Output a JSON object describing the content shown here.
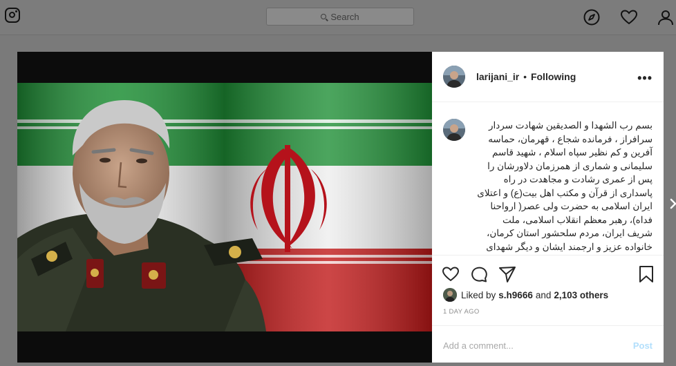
{
  "topbar": {
    "search_placeholder": "Search"
  },
  "post": {
    "username": "larijani_ir",
    "separator": "•",
    "follow_status": "Following",
    "more_label": "•••",
    "caption": "بسم رب الشهدا و الصدیقین شهادت سردار سرافراز ، فرمانده شجاع ، قهرمان، حماسه آفرین و کم نظیر سپاه اسلام ، شهید قاسم سلیمانی و شماری از همرزمان دلاورشان را پس از عمری رشادت و مجاهدت در راه پاسداری از قرآن و مکتب اهل بیت(ع) و اعتلای ایران اسلامی به حضرت ولی عصر( ارواحنا فداه)، رهبر معظم انقلاب اسلامی، ملت شریف ایران، مردم سلحشور استان کرمان، خانواده عزیز و ارجمند ایشان و دیگر شهدای",
    "liked_by_prefix": "Liked by",
    "liked_by_user": "s.h9666",
    "liked_and": "and",
    "liked_others": "2,103 others",
    "time_ago": "1 DAY AGO",
    "comment_placeholder": "Add a comment...",
    "post_button": "Post"
  },
  "colors": {
    "backdrop": "#7a7a7a",
    "post_button": "#b2dffc",
    "flag_green": "#239f40",
    "flag_red": "#da0000",
    "emblem_red": "#c8102e"
  },
  "icons": [
    "instagram-icon",
    "search-icon",
    "compass-icon",
    "heart-icon",
    "profile-icon",
    "like-icon",
    "comment-icon",
    "share-icon",
    "bookmark-icon",
    "next-arrow-icon"
  ]
}
